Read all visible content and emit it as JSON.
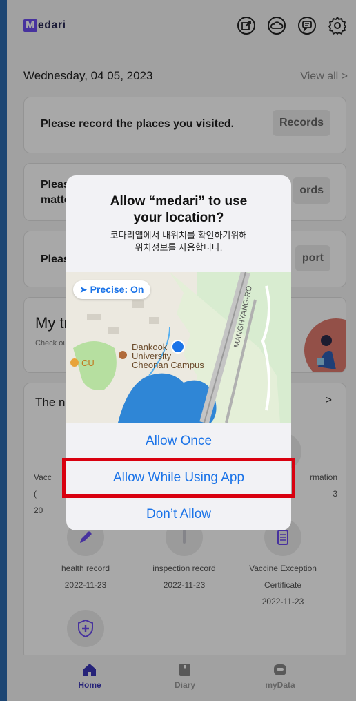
{
  "app": {
    "logo_text": "edari",
    "logo_initial": "M"
  },
  "header_icons": [
    "share-icon",
    "cloud-icon",
    "chat-icon",
    "settings-icon"
  ],
  "date_row": {
    "date": "Wednesday, 04 05, 2023",
    "view_all": "View all >"
  },
  "cards": [
    {
      "text": "Please record the places you visited.",
      "button": "Records"
    },
    {
      "text_line1": "Please",
      "text_line2": "matte",
      "button": "ords"
    },
    {
      "text": "Please",
      "button": "port"
    }
  ],
  "my_trip": {
    "title": "My tr",
    "subtitle": "Check ou"
  },
  "numbers": {
    "title": "The nu",
    "chevron": ">",
    "left_partial": {
      "line1": "Vacc",
      "line2": "(",
      "line3": "20"
    },
    "right_partial": {
      "line1": "rmation",
      "line2": "3"
    },
    "items": [
      {
        "label": "health record",
        "date": "2022-11-23",
        "icon": "pencil-icon"
      },
      {
        "label": "inspection record",
        "date": "2022-11-23",
        "icon": "test-tube-icon"
      },
      {
        "label": "Vaccine Exception",
        "label2": "Certificate",
        "date": "2022-11-23",
        "icon": "checklist-icon"
      }
    ]
  },
  "bottom_nav": {
    "home": "Home",
    "diary": "Diary",
    "mydata": "myData"
  },
  "alert": {
    "title_line1": "Allow “medari” to use",
    "title_line2": "your location?",
    "message_line1": "코다리앱에서 내위치를 확인하기위해",
    "message_line2": "위치정보를 사용합니다.",
    "precise": "Precise: On",
    "map_labels": {
      "place_line1": "Dankook",
      "place_line2": "University",
      "place_line3": "Cheonan Campus",
      "cu": "CU",
      "road": "MANGHYANG-RO"
    },
    "buttons": {
      "allow_once": "Allow Once",
      "allow_while_using": "Allow While Using App",
      "dont_allow": "Don’t Allow"
    }
  },
  "colors": {
    "accent_blue": "#1a73e8",
    "highlight_red": "#d9000f",
    "brand_purple": "#6c4cf0",
    "nav_active": "#3a36b8",
    "outer_background": "#1d4673"
  }
}
